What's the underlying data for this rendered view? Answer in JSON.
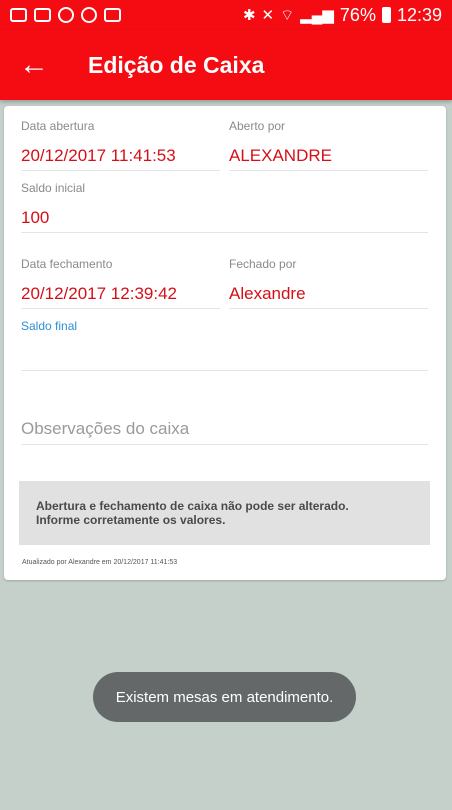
{
  "status_bar": {
    "battery": "76%",
    "time": "12:39"
  },
  "header": {
    "back_icon": "arrow-left-icon",
    "title": "Edição de Caixa"
  },
  "form": {
    "data_abertura_label": "Data abertura",
    "data_abertura_value": "20/12/2017 11:41:53",
    "aberto_por_label": "Aberto por",
    "aberto_por_value": "ALEXANDRE",
    "saldo_inicial_label": "Saldo inicial",
    "saldo_inicial_value": "100",
    "data_fechamento_label": "Data fechamento",
    "data_fechamento_value": "20/12/2017 12:39:42",
    "fechado_por_label": "Fechado por",
    "fechado_por_value": "Alexandre",
    "saldo_final_label": "Saldo final",
    "saldo_final_value": "",
    "observacoes_placeholder": "Observações do caixa"
  },
  "warning": {
    "line1": "Abertura e fechamento de caixa não pode ser alterado.",
    "line2": "Informe corretamente os valores."
  },
  "updated_text": "Atualizado por Alexandre em 20/12/2017 11:41:53",
  "toast": "Existem mesas em atendimento.",
  "colors": {
    "primary": "#f40c12",
    "value_text": "#d60f17",
    "link_label": "#2e8fd6",
    "background": "#c5d0cb"
  }
}
